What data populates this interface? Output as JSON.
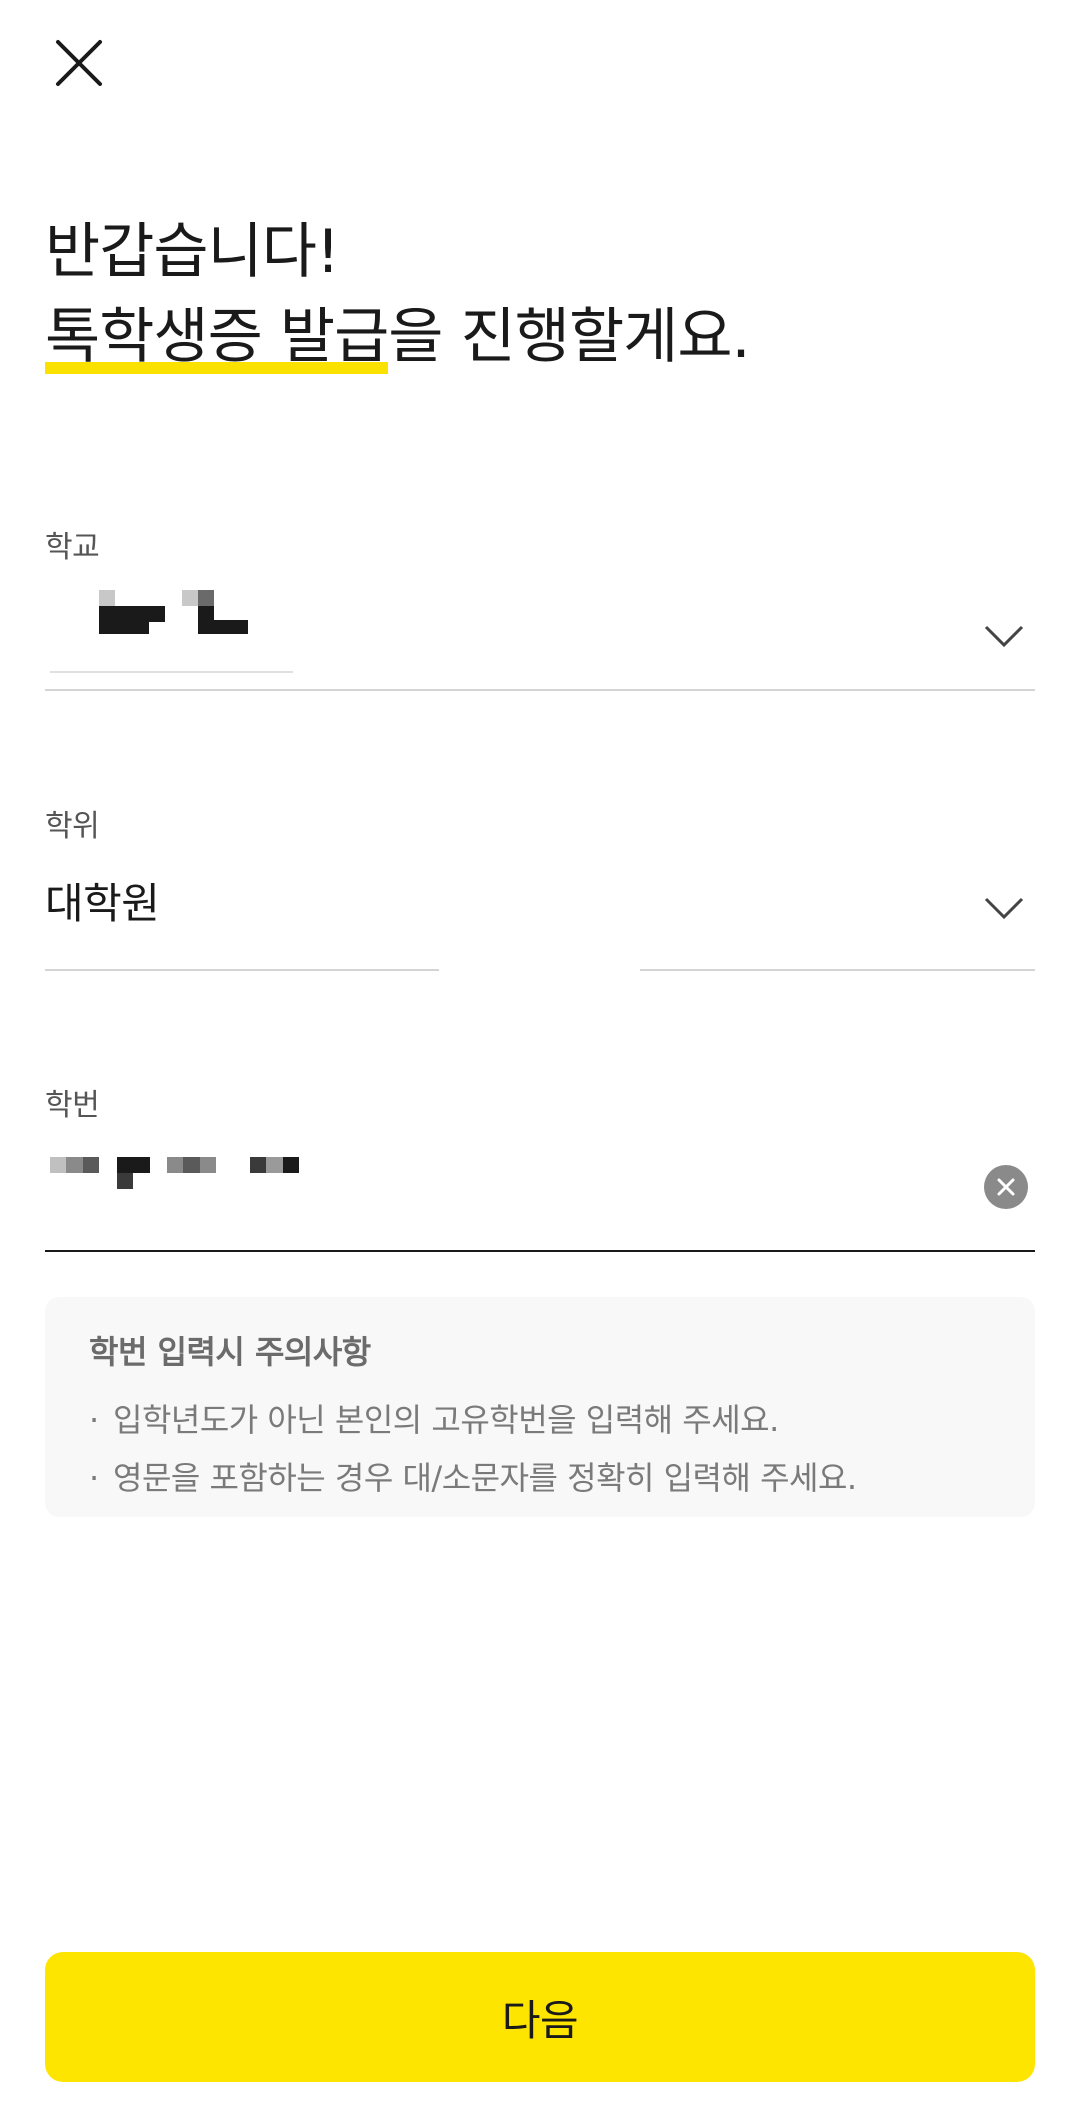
{
  "header": {
    "close_icon": "close-icon"
  },
  "greeting": {
    "line1": "반갑습니다!",
    "line2_highlight": "톡학생증 발급",
    "line2_rest": "을 진행할게요.",
    "highlight_color": "#fae100"
  },
  "fields": {
    "school": {
      "label": "학교",
      "value": ""
    },
    "degree": {
      "label": "학위",
      "value": "대학원"
    },
    "student_id": {
      "label": "학번",
      "value": ""
    }
  },
  "notice": {
    "title": "학번 입력시 주의사항",
    "bullet": "·",
    "items": [
      "입학년도가 아닌 본인의 고유학번을 입력해 주세요.",
      "영문을 포함하는 경우 대/소문자를 정확히 입력해 주세요."
    ]
  },
  "footer": {
    "next_label": "다음",
    "button_color": "#fee500"
  }
}
